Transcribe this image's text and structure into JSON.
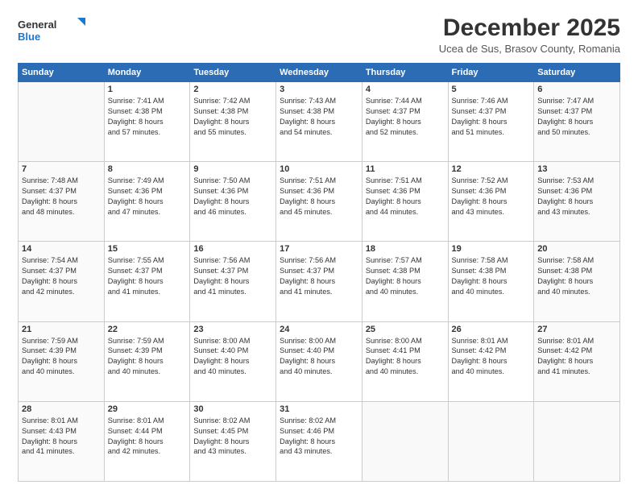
{
  "header": {
    "logo": {
      "general": "General",
      "blue": "Blue"
    },
    "title": "December 2025",
    "location": "Ucea de Sus, Brasov County, Romania"
  },
  "weekdays": [
    "Sunday",
    "Monday",
    "Tuesday",
    "Wednesday",
    "Thursday",
    "Friday",
    "Saturday"
  ],
  "weeks": [
    [
      {
        "day": "",
        "info": ""
      },
      {
        "day": "1",
        "info": "Sunrise: 7:41 AM\nSunset: 4:38 PM\nDaylight: 8 hours\nand 57 minutes."
      },
      {
        "day": "2",
        "info": "Sunrise: 7:42 AM\nSunset: 4:38 PM\nDaylight: 8 hours\nand 55 minutes."
      },
      {
        "day": "3",
        "info": "Sunrise: 7:43 AM\nSunset: 4:38 PM\nDaylight: 8 hours\nand 54 minutes."
      },
      {
        "day": "4",
        "info": "Sunrise: 7:44 AM\nSunset: 4:37 PM\nDaylight: 8 hours\nand 52 minutes."
      },
      {
        "day": "5",
        "info": "Sunrise: 7:46 AM\nSunset: 4:37 PM\nDaylight: 8 hours\nand 51 minutes."
      },
      {
        "day": "6",
        "info": "Sunrise: 7:47 AM\nSunset: 4:37 PM\nDaylight: 8 hours\nand 50 minutes."
      }
    ],
    [
      {
        "day": "7",
        "info": "Sunrise: 7:48 AM\nSunset: 4:37 PM\nDaylight: 8 hours\nand 48 minutes."
      },
      {
        "day": "8",
        "info": "Sunrise: 7:49 AM\nSunset: 4:36 PM\nDaylight: 8 hours\nand 47 minutes."
      },
      {
        "day": "9",
        "info": "Sunrise: 7:50 AM\nSunset: 4:36 PM\nDaylight: 8 hours\nand 46 minutes."
      },
      {
        "day": "10",
        "info": "Sunrise: 7:51 AM\nSunset: 4:36 PM\nDaylight: 8 hours\nand 45 minutes."
      },
      {
        "day": "11",
        "info": "Sunrise: 7:51 AM\nSunset: 4:36 PM\nDaylight: 8 hours\nand 44 minutes."
      },
      {
        "day": "12",
        "info": "Sunrise: 7:52 AM\nSunset: 4:36 PM\nDaylight: 8 hours\nand 43 minutes."
      },
      {
        "day": "13",
        "info": "Sunrise: 7:53 AM\nSunset: 4:36 PM\nDaylight: 8 hours\nand 43 minutes."
      }
    ],
    [
      {
        "day": "14",
        "info": "Sunrise: 7:54 AM\nSunset: 4:37 PM\nDaylight: 8 hours\nand 42 minutes."
      },
      {
        "day": "15",
        "info": "Sunrise: 7:55 AM\nSunset: 4:37 PM\nDaylight: 8 hours\nand 41 minutes."
      },
      {
        "day": "16",
        "info": "Sunrise: 7:56 AM\nSunset: 4:37 PM\nDaylight: 8 hours\nand 41 minutes."
      },
      {
        "day": "17",
        "info": "Sunrise: 7:56 AM\nSunset: 4:37 PM\nDaylight: 8 hours\nand 41 minutes."
      },
      {
        "day": "18",
        "info": "Sunrise: 7:57 AM\nSunset: 4:38 PM\nDaylight: 8 hours\nand 40 minutes."
      },
      {
        "day": "19",
        "info": "Sunrise: 7:58 AM\nSunset: 4:38 PM\nDaylight: 8 hours\nand 40 minutes."
      },
      {
        "day": "20",
        "info": "Sunrise: 7:58 AM\nSunset: 4:38 PM\nDaylight: 8 hours\nand 40 minutes."
      }
    ],
    [
      {
        "day": "21",
        "info": "Sunrise: 7:59 AM\nSunset: 4:39 PM\nDaylight: 8 hours\nand 40 minutes."
      },
      {
        "day": "22",
        "info": "Sunrise: 7:59 AM\nSunset: 4:39 PM\nDaylight: 8 hours\nand 40 minutes."
      },
      {
        "day": "23",
        "info": "Sunrise: 8:00 AM\nSunset: 4:40 PM\nDaylight: 8 hours\nand 40 minutes."
      },
      {
        "day": "24",
        "info": "Sunrise: 8:00 AM\nSunset: 4:40 PM\nDaylight: 8 hours\nand 40 minutes."
      },
      {
        "day": "25",
        "info": "Sunrise: 8:00 AM\nSunset: 4:41 PM\nDaylight: 8 hours\nand 40 minutes."
      },
      {
        "day": "26",
        "info": "Sunrise: 8:01 AM\nSunset: 4:42 PM\nDaylight: 8 hours\nand 40 minutes."
      },
      {
        "day": "27",
        "info": "Sunrise: 8:01 AM\nSunset: 4:42 PM\nDaylight: 8 hours\nand 41 minutes."
      }
    ],
    [
      {
        "day": "28",
        "info": "Sunrise: 8:01 AM\nSunset: 4:43 PM\nDaylight: 8 hours\nand 41 minutes."
      },
      {
        "day": "29",
        "info": "Sunrise: 8:01 AM\nSunset: 4:44 PM\nDaylight: 8 hours\nand 42 minutes."
      },
      {
        "day": "30",
        "info": "Sunrise: 8:02 AM\nSunset: 4:45 PM\nDaylight: 8 hours\nand 43 minutes."
      },
      {
        "day": "31",
        "info": "Sunrise: 8:02 AM\nSunset: 4:46 PM\nDaylight: 8 hours\nand 43 minutes."
      },
      {
        "day": "",
        "info": ""
      },
      {
        "day": "",
        "info": ""
      },
      {
        "day": "",
        "info": ""
      }
    ]
  ]
}
